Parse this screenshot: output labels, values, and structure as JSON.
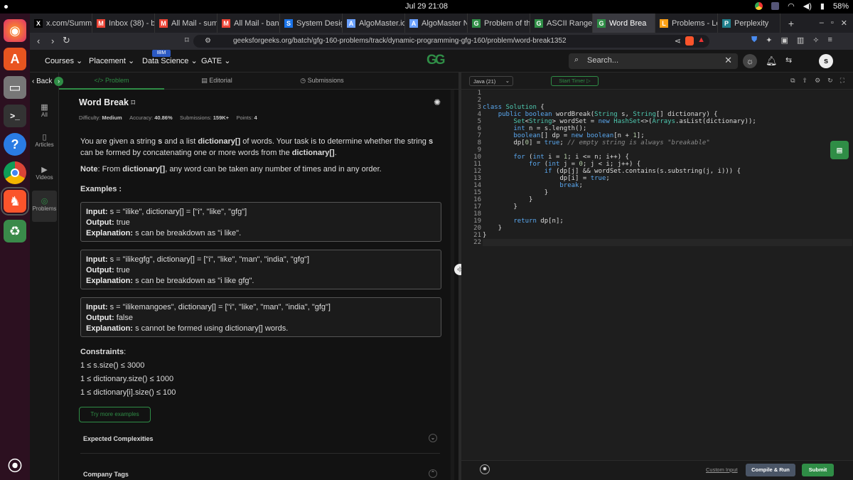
{
  "system": {
    "clock": "Jul 29  21:08",
    "battery": "58%"
  },
  "browser": {
    "tabs": [
      {
        "label": "x.com/Summ",
        "icon": "X"
      },
      {
        "label": "Inbox (38) - b",
        "icon": "M"
      },
      {
        "label": "All Mail - sum",
        "icon": "M"
      },
      {
        "label": "All Mail - banc",
        "icon": "M"
      },
      {
        "label": "System Desig",
        "icon": "S"
      },
      {
        "label": "AlgoMaster.io",
        "icon": "A"
      },
      {
        "label": "AlgoMaster N",
        "icon": "A"
      },
      {
        "label": "Problem of th",
        "icon": "G"
      },
      {
        "label": "ASCII Range S",
        "icon": "G"
      },
      {
        "label": "Word Brea",
        "icon": "G"
      },
      {
        "label": "Problems - Le",
        "icon": "L"
      },
      {
        "label": "Perplexity",
        "icon": "P"
      }
    ],
    "url": "geeksforgeeks.org/batch/gfg-160-problems/track/dynamic-programming-gfg-160/problem/word-break1352"
  },
  "nav": {
    "courses": "Courses",
    "placement": "Placement",
    "ibm_badge": "IBM",
    "data_science": "Data Science",
    "gate": "GATE",
    "logo": "GG",
    "search_placeholder": "Search...",
    "avatar": "s"
  },
  "rail": {
    "back": "Back",
    "all": "All",
    "articles": "Articles",
    "videos": "Videos",
    "problems": "Problems"
  },
  "subnav": {
    "problem": "Problem",
    "editorial": "Editorial",
    "submissions": "Submissions"
  },
  "problem": {
    "title": "Word Break",
    "difficulty_label": "Difficulty:",
    "difficulty": "Medium",
    "accuracy_label": "Accuracy:",
    "accuracy": "40.86%",
    "submissions_label": "Submissions:",
    "submissions": "159K+",
    "points_label": "Points:",
    "points": "4",
    "desc_1": "You are given a string ",
    "desc_s": "s",
    "desc_2": " and a list ",
    "desc_dict": "dictionary[]",
    "desc_3": " of words. Your task is to determine whether the string ",
    "desc_s2": "s",
    "desc_4": " can be formed by concatenating one or more words from the ",
    "desc_dict2": "dictionary[]",
    "desc_5": ".",
    "note_label": "Note",
    "note_1": ": From ",
    "note_dict": "dictionary[]",
    "note_2": ", any word can be taken any number of times and in any order.",
    "examples_title": "Examples :",
    "examples": [
      {
        "input_label": "Input:",
        "input": " s = \"ilike\", dictionary[] = [\"i\", \"like\", \"gfg\"]",
        "output_label": "Output:",
        "output": " true",
        "expl_label": "Explanation:",
        "expl": " s can be breakdown as \"i like\"."
      },
      {
        "input_label": "Input:",
        "input": " s = \"ilikegfg\", dictionary[] = [\"i\", \"like\", \"man\", \"india\", \"gfg\"]",
        "output_label": "Output:",
        "output": " true",
        "expl_label": "Explanation:",
        "expl": " s can be breakdown as \"i like gfg\"."
      },
      {
        "input_label": "Input:",
        "input": " s = \"ilikemangoes\", dictionary[] = [\"i\", \"like\", \"man\", \"india\", \"gfg\"]",
        "output_label": "Output:",
        "output": " false",
        "expl_label": "Explanation:",
        "expl": " s cannot be formed using dictionary[] words."
      }
    ],
    "constraints_title": "Constraints",
    "constraints_colon": ":",
    "constraints": [
      "1 ≤ s.size() ≤ 3000",
      "1 ≤ dictionary.size() ≤ 1000",
      "1 ≤ dictionary[i].size() ≤ 100"
    ],
    "try_more": "Try more examples",
    "expected_complexities": "Expected Complexities",
    "company_tags": "Company Tags"
  },
  "editor": {
    "language": "Java (21)",
    "start_timer": "Start Timer",
    "line_numbers": [
      "1",
      "2",
      "3",
      "4",
      "5",
      "6",
      "7",
      "8",
      "9",
      "10",
      "11",
      "12",
      "13",
      "14",
      "15",
      "16",
      "17",
      "18",
      "19",
      "20",
      "21",
      "22"
    ],
    "custom_input": "Custom Input",
    "compile_run": "Compile & Run",
    "submit": "Submit"
  }
}
